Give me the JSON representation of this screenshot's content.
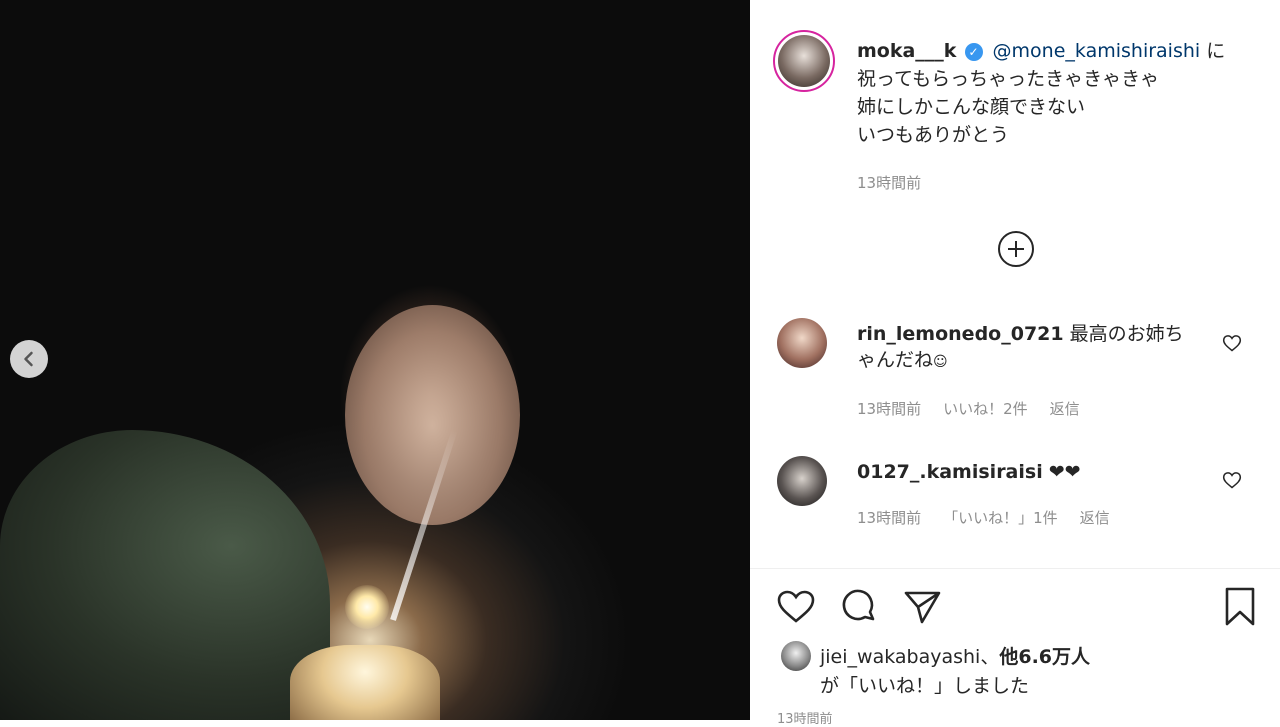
{
  "post": {
    "username": "moka___k",
    "mention": "@mone_kamishiraishi",
    "caption_line1_suffix": " に",
    "caption_line2": "祝ってもらっちゃったきゃきゃきゃ",
    "caption_line3": "姉にしかこんな顔できない",
    "caption_line4": "いつもありがとう",
    "time": "13時間前"
  },
  "comments": [
    {
      "username": "rin_lemonedo_0721",
      "text": " 最高のお姉ちゃんだね",
      "emoji": "☺",
      "time": "13時間前",
      "likes": "いいね！2件",
      "reply": "返信"
    },
    {
      "username": "0127_.kamisiraisi",
      "text": " ❤❤",
      "time": "13時間前",
      "likes": "「いいね！」1件",
      "reply": "返信"
    }
  ],
  "likes": {
    "liker": "jiei_wakabayashi",
    "sep": "、",
    "others": "他6.6万人",
    "suffix": "が「いいね！」しました"
  },
  "footer_time": "13時間前",
  "colors": {
    "verified": "#3897f0",
    "mention": "#00376b",
    "muted": "#8e8e8e",
    "text": "#262626"
  },
  "icons": [
    "chevron-left-icon",
    "verified-badge-icon",
    "plus-circle-icon",
    "heart-icon",
    "comment-icon",
    "share-icon",
    "bookmark-icon"
  ]
}
